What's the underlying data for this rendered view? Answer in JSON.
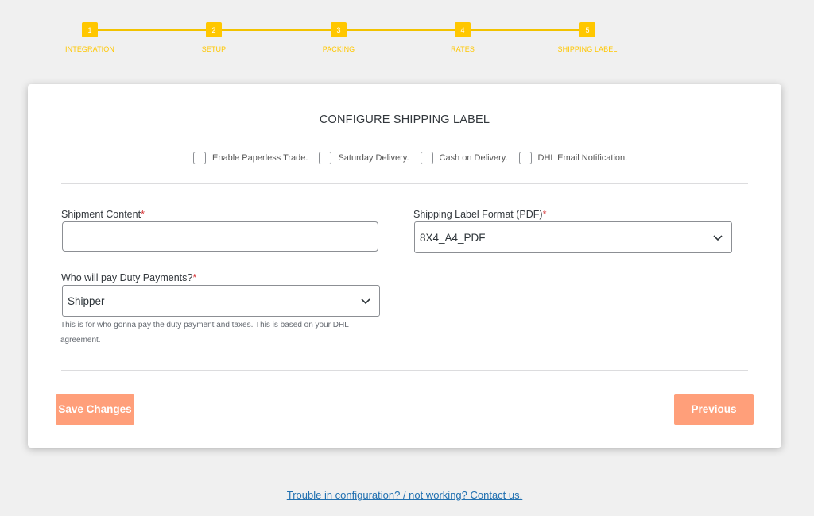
{
  "stepper": {
    "steps": [
      {
        "number": "1",
        "label": "INTEGRATION"
      },
      {
        "number": "2",
        "label": "SETUP"
      },
      {
        "number": "3",
        "label": "PACKING"
      },
      {
        "number": "4",
        "label": "RATES"
      },
      {
        "number": "5",
        "label": "SHIPPING LABEL"
      }
    ],
    "active_color": "#ffc700"
  },
  "card": {
    "title": "CONFIGURE SHIPPING LABEL",
    "options": [
      {
        "label": "Enable Paperless Trade.",
        "checked": false
      },
      {
        "label": "Saturday Delivery.",
        "checked": false
      },
      {
        "label": "Cash on Delivery.",
        "checked": false
      },
      {
        "label": "DHL Email Notification.",
        "checked": false
      }
    ],
    "shipment_content": {
      "label": "Shipment Content",
      "required": "*",
      "value": ""
    },
    "label_format": {
      "label": "Shipping Label Format (PDF)",
      "required": "*",
      "selected": "8X4_A4_PDF"
    },
    "duty_payments": {
      "label": "Who will pay Duty Payments?",
      "required": "*",
      "selected": "Shipper",
      "help": "This is for who gonna pay the duty payment and taxes. This is based on your DHL agreement."
    },
    "save_label": "Save Changes",
    "previous_label": "Previous"
  },
  "footer": {
    "link_text": "Trouble in configuration? / not working? Contact us."
  },
  "colors": {
    "accent": "#ff9f7a",
    "stepper": "#ffc700",
    "link": "#2271b1",
    "background": "#f0f0f0"
  }
}
